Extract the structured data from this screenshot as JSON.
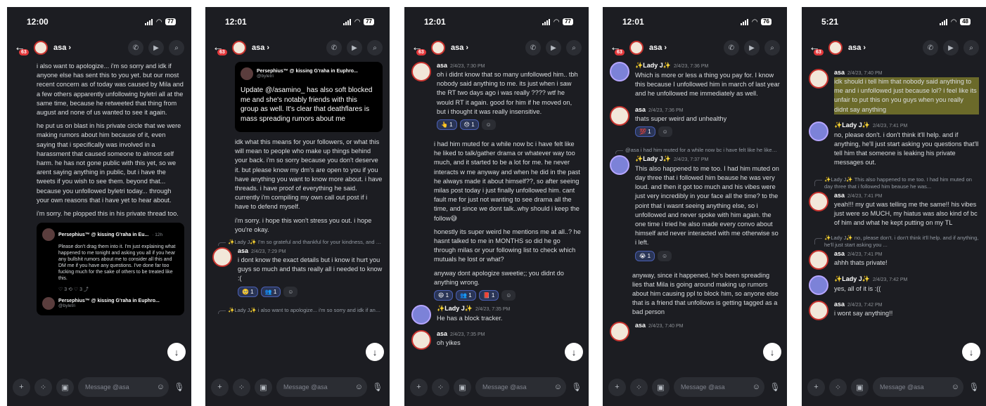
{
  "screens": [
    {
      "time": "12:00",
      "battery": "77",
      "notif": "63",
      "contact": "asa ›",
      "block1": "i also want to apologize... i'm so sorry and idk if anyone else has sent this to you yet. but our most recent concern as of today was caused by Mila and a few others apparently unfollowing byletri all at the same time, because he retweeted that thing from august and none of us wanted to see it again.",
      "block2": "he put us on blast in his private circle that we were making rumors about him because of it, even saying that i specifically was involved in a harassment that caused someone to almost self harm. he has not gone public with this yet, so we arent saying anything in public, but i have the tweets if you wish to see them. beyond that... because you unfollowed byletri today... through your own reasons that i have yet to hear about.",
      "block3": "i'm sorry. he plopped this in his private thread too.",
      "embed_name": "Persephius™ @ kissing G'raha in Eu...",
      "embed_age": "· 12h",
      "embed_text": "Please don't drag them into it. I'm just explaining what happened to me tonight and asking you all if you hear any bullshit rumors about me to consider all this and DM me if you have any questions. I've done far too fucking much for the sake of others to be treated like this.",
      "embed_actions": "♡ 3     ⟲     ♡ 3     ⤴",
      "embed2_name": "Persephius™ @ kissing G'raha in Euphro...",
      "embed2_handle": "@byletri"
    },
    {
      "time": "12:01",
      "battery": "77",
      "notif": "63",
      "contact": "asa ›",
      "embed_name": "Persephius™ @ kissing G'raha in Euphro...",
      "embed_handle": "@byletri",
      "embed_text": "Update @/asamino_ has also soft blocked me and she's notably friends with this group as well. It's clear that deathflares is mass spreading rumors about me",
      "block1": "idk what this means for your followers, or what this will mean to people who make up things behind your back. i'm so sorry because you don't deserve it. but please know my dm's are open to you if you have anything you want to know more about. i have threads. i have proof of everything he said. currently i'm compiling my own call out post if i have to defend myself.",
      "block2": "i'm sorry. i hope this won't stress you out. i hope you're okay.",
      "reply1": "✨Lady J✨ I'm so grateful and thankful for your kindness, and for just trusting us, more than anything...",
      "msg_name": "asa",
      "msg_time": "2/4/23, 7:29 PM",
      "msg_text": "i dont know the exact details but i know it hurt you guys so much and thats really all i needed to know :(",
      "reactions": [
        "🥺 1",
        "👥 1",
        "☺"
      ],
      "reply2": "✨Lady J✨ i also want to apologize... i'm so sorry and idk if anyone else has sent this to you yet. but our..."
    },
    {
      "time": "12:01",
      "battery": "77",
      "notif": "63",
      "contact": "asa ›",
      "msg1_name": "asa",
      "msg1_time": "2/4/23, 7:30 PM",
      "msg1_text": "oh i didnt know that so many unfollowed him.. tbh nobody said anything to me. its just when i saw the RT two days ago i was really ???? wtf he would RT it again. good for him if he moved on, but i thought it was really insensitive.",
      "reactions1": [
        "👆 1",
        "😞 1",
        "☺"
      ],
      "block1": "i had him muted for a while now bc i have felt like he liked to talk/gather drama or whatever way too much, and it started to be a lot for me. he never interacts w me anyway and when he did in the past he always made it about himself??, so after seeing milas post today i just finally unfollowed him. cant fault me for just not wanting to see drama all the time, and since we dont talk..why should i keep the follow😅",
      "block2": "honestly its super weird he mentions me at all..? he hasnt talked to me in MONTHS so did he go through milas or your following list to check which mutuals he lost or what?",
      "block3": "anyway dont apologize sweetie;; you didnt do anything wrong.",
      "reactions2": [
        "😄 1",
        "👥 1",
        "📕 1",
        "☺"
      ],
      "msg2_name": "✨Lady J✨",
      "msg2_time": "2/4/23, 7:35 PM",
      "msg2_text": "He has a block tracker.",
      "msg3_name": "asa",
      "msg3_time": "2/4/23, 7:35 PM",
      "msg3_text": "oh yikes"
    },
    {
      "time": "12:01",
      "battery": "76",
      "notif": "63",
      "contact": "asa ›",
      "msg1_name": "✨Lady J✨",
      "msg1_time": "2/4/23, 7:36 PM",
      "msg1_text": "Which is more or less a thing you pay for. I know this because I unfollowed him in march of last year and he unfollowed me immediately as well.",
      "msg2_name": "asa",
      "msg2_time": "2/4/23, 7:36 PM",
      "msg2_text": "thats super weird and unhealthy",
      "reactions2": [
        "💯 1",
        "☺"
      ],
      "reply": "@asa i had him muted for a while now bc i have felt like he liked to talk/gather drama or whatever wa...",
      "msg3_name": "✨Lady J✨",
      "msg3_time": "2/4/23, 7:37 PM",
      "msg3_text": "This also happened to me too. I had him muted on day three that i followed him beause he was very loud. and then it got too much and his vibes were just very incredibly in your face all the time? to the point that i wasnt seeing anything else, so i unfollowed and never spoke with him again. the one time i tried he also made every convo about himself and never interacted with me otherwise so i left.",
      "reactions3": [
        "😭 1",
        "☺"
      ],
      "block1": "anyway, since it happened, he's been spreading lies that Mila is going around making up rumors about him causing ppl to block him, so anyone else that is a friend that unfollows is getting tagged as a bad person",
      "msg4_name": "asa",
      "msg4_time": "2/4/23, 7:40 PM"
    },
    {
      "time": "5:21",
      "battery": "48",
      "notif": "63",
      "contact": "asa ›",
      "msg1_name": "asa",
      "msg1_time": "2/4/23, 7:40 PM",
      "msg1_text": "idk should i tell him that nobody said anything to me and i  unfollowed just because lol? i feel like its unfair to put this on you guys when you really didnt say anything",
      "msg2_name": "✨Lady J✨",
      "msg2_time": "2/4/23, 7:41 PM",
      "msg2_text": "no, please don't. i don't think it'll help. and if anything, he'll just start asking you questions that'll tell him that someone is leaking his private messages out.",
      "reply1": "✨Lady J✨ This also happened to me too. I had him muted on day three that i followed him beause he was...",
      "msg3_name": "asa",
      "msg3_time": "2/4/23, 7:41 PM",
      "msg3_text": "yeah!!! my gut was telling me  the same!! his vibes just were so MUCH, my hiatus was also kind of bc of him and what he kept putting on my TL",
      "reply2": "✨Lady J✨ no, please don't. i don't think it'll help. and if anything, he'll just start asking you ...",
      "msg4_name": "asa",
      "msg4_time": "2/4/23, 7:41 PM",
      "msg4_text": "ahhh thats private!",
      "msg5_name": "✨Lady J✨",
      "msg5_time": "2/4/23, 7:42 PM",
      "msg5_text": "yes, all of it is :((",
      "msg6_name": "asa",
      "msg6_time": "2/4/23, 7:42 PM",
      "msg6_text": "i wont say anything!!"
    }
  ],
  "composer_placeholder": "Message @asa"
}
